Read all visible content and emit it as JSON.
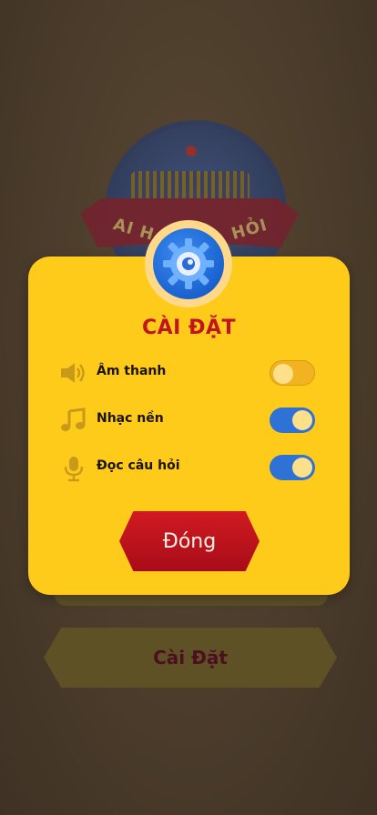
{
  "background": {
    "logo_text_left": "AI H",
    "logo_text_right": "HỎI",
    "settings_button_label": "Cài Đặt"
  },
  "settings_modal": {
    "title": "CÀI ĐẶT",
    "options": [
      {
        "label": "Âm thanh",
        "icon": "speaker-icon",
        "enabled": false
      },
      {
        "label": "Nhạc nền",
        "icon": "music-note-icon",
        "enabled": true
      },
      {
        "label": "Đọc câu hỏi",
        "icon": "microphone-icon",
        "enabled": true
      }
    ],
    "close_label": "Đóng",
    "badge_icon": "gear-icon"
  },
  "colors": {
    "modal_bg": "#ffcb1a",
    "title_red": "#c01520",
    "toggle_on": "#2f72d6",
    "toggle_off": "#f1b320",
    "close_button": "#c01520"
  }
}
